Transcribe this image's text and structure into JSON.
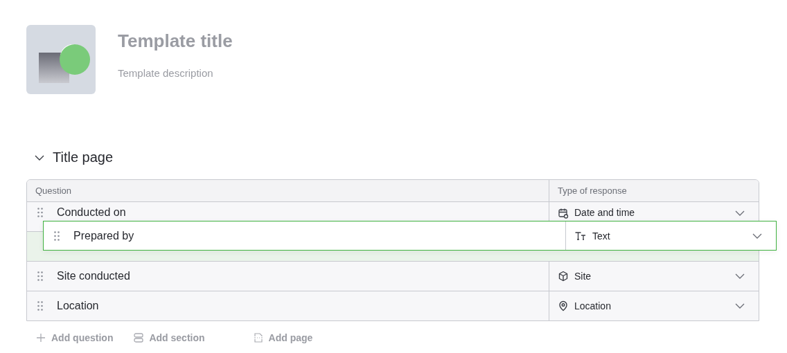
{
  "template": {
    "title": "Template title",
    "description": "Template description"
  },
  "section": {
    "title": "Title page",
    "expanded": true
  },
  "table": {
    "columns": [
      "Question",
      "Type of response"
    ],
    "rows": [
      {
        "kind": "question",
        "question": "Conducted on",
        "response": {
          "label": "Date and time",
          "kind": "datetime"
        }
      },
      {
        "kind": "drop_placeholder"
      },
      {
        "kind": "question",
        "question": "Site conducted",
        "response": {
          "label": "Site",
          "kind": "site"
        }
      },
      {
        "kind": "question",
        "question": "Location",
        "response": {
          "label": "Location",
          "kind": "location"
        }
      }
    ]
  },
  "dragged_row": {
    "question": "Prepared by",
    "response": {
      "label": "Text",
      "kind": "text"
    }
  },
  "actions": [
    {
      "label": "Add question",
      "kind": "question"
    },
    {
      "label": "Add section",
      "kind": "section"
    },
    {
      "label": "Add page",
      "kind": "page"
    }
  ]
}
